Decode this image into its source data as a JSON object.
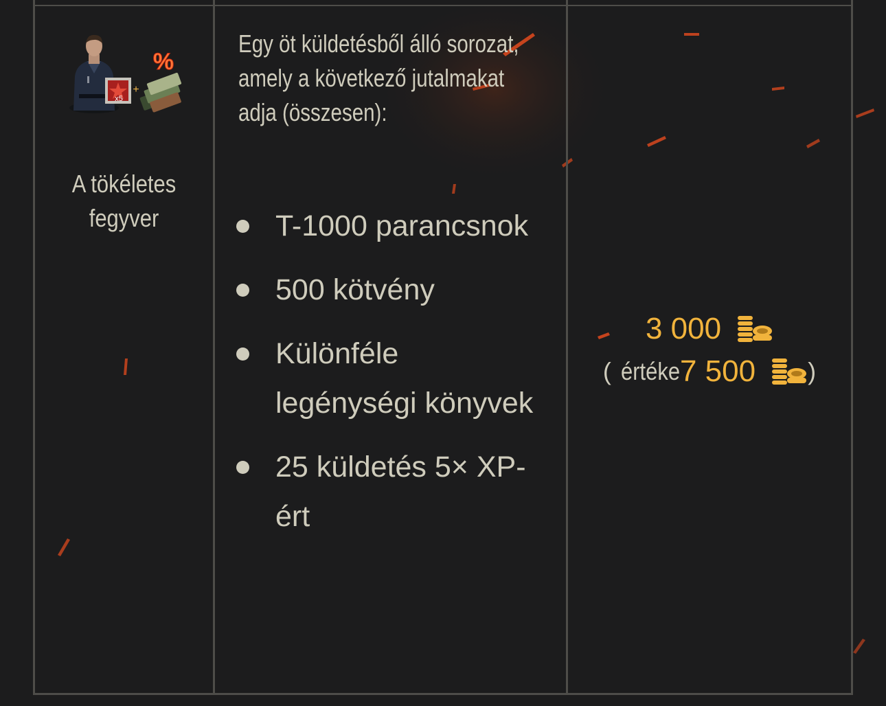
{
  "mission": {
    "name": "A tökéletes fegyver",
    "description": "Egy öt küldetésből álló sorozat, amely a következő jutalmakat adja (összesen):",
    "rewards": [
      "T-1000 parancsnok",
      "500 kötvény",
      "Különféle legénységi könyvek",
      "25 küldetés 5× XP-ért"
    ],
    "icon": {
      "name": "commander-with-discount-bundle-icon",
      "multiplier": "x5",
      "percent_badge": "%"
    }
  },
  "price": {
    "amount": "3 000",
    "value_open": "(",
    "value_label": "értéke",
    "value_amount": "7 500",
    "value_close": ")",
    "currency_icon": "gold-coins-icon"
  },
  "colors": {
    "background": "#1c1c1d",
    "border": "#4e4d49",
    "text": "#cfccbc",
    "gold": "#f1b33c",
    "ember": "#d8481e"
  }
}
